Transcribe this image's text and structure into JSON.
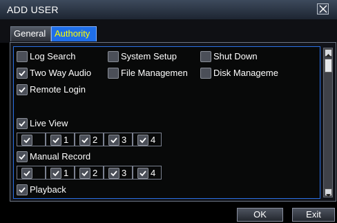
{
  "window": {
    "title": "ADD USER"
  },
  "tabs": [
    {
      "label": "General",
      "active": false
    },
    {
      "label": "Authority",
      "active": true
    }
  ],
  "permissions": {
    "log_search": {
      "label": "Log Search",
      "checked": false
    },
    "system_setup": {
      "label": "System Setup",
      "checked": false
    },
    "shut_down": {
      "label": "Shut Down",
      "checked": false
    },
    "two_way_audio": {
      "label": "Two Way Audio",
      "checked": true
    },
    "file_management": {
      "label": "File Managemen",
      "checked": false
    },
    "disk_management": {
      "label": "Disk Manageme",
      "checked": false
    },
    "remote_login": {
      "label": "Remote Login",
      "checked": true
    },
    "live_view": {
      "label": "Live View",
      "checked": true,
      "channels": [
        "",
        "1",
        "2",
        "3",
        "4"
      ]
    },
    "manual_record": {
      "label": "Manual Record",
      "checked": true,
      "channels": [
        "",
        "1",
        "2",
        "3",
        "4"
      ]
    },
    "playback": {
      "label": "Playback",
      "checked": true
    }
  },
  "buttons": {
    "ok": "OK",
    "exit": "Exit"
  },
  "colors": {
    "accent": "#1f6ee8",
    "active_tab_text": "#ffff00",
    "content_border": "#2a70e5"
  }
}
